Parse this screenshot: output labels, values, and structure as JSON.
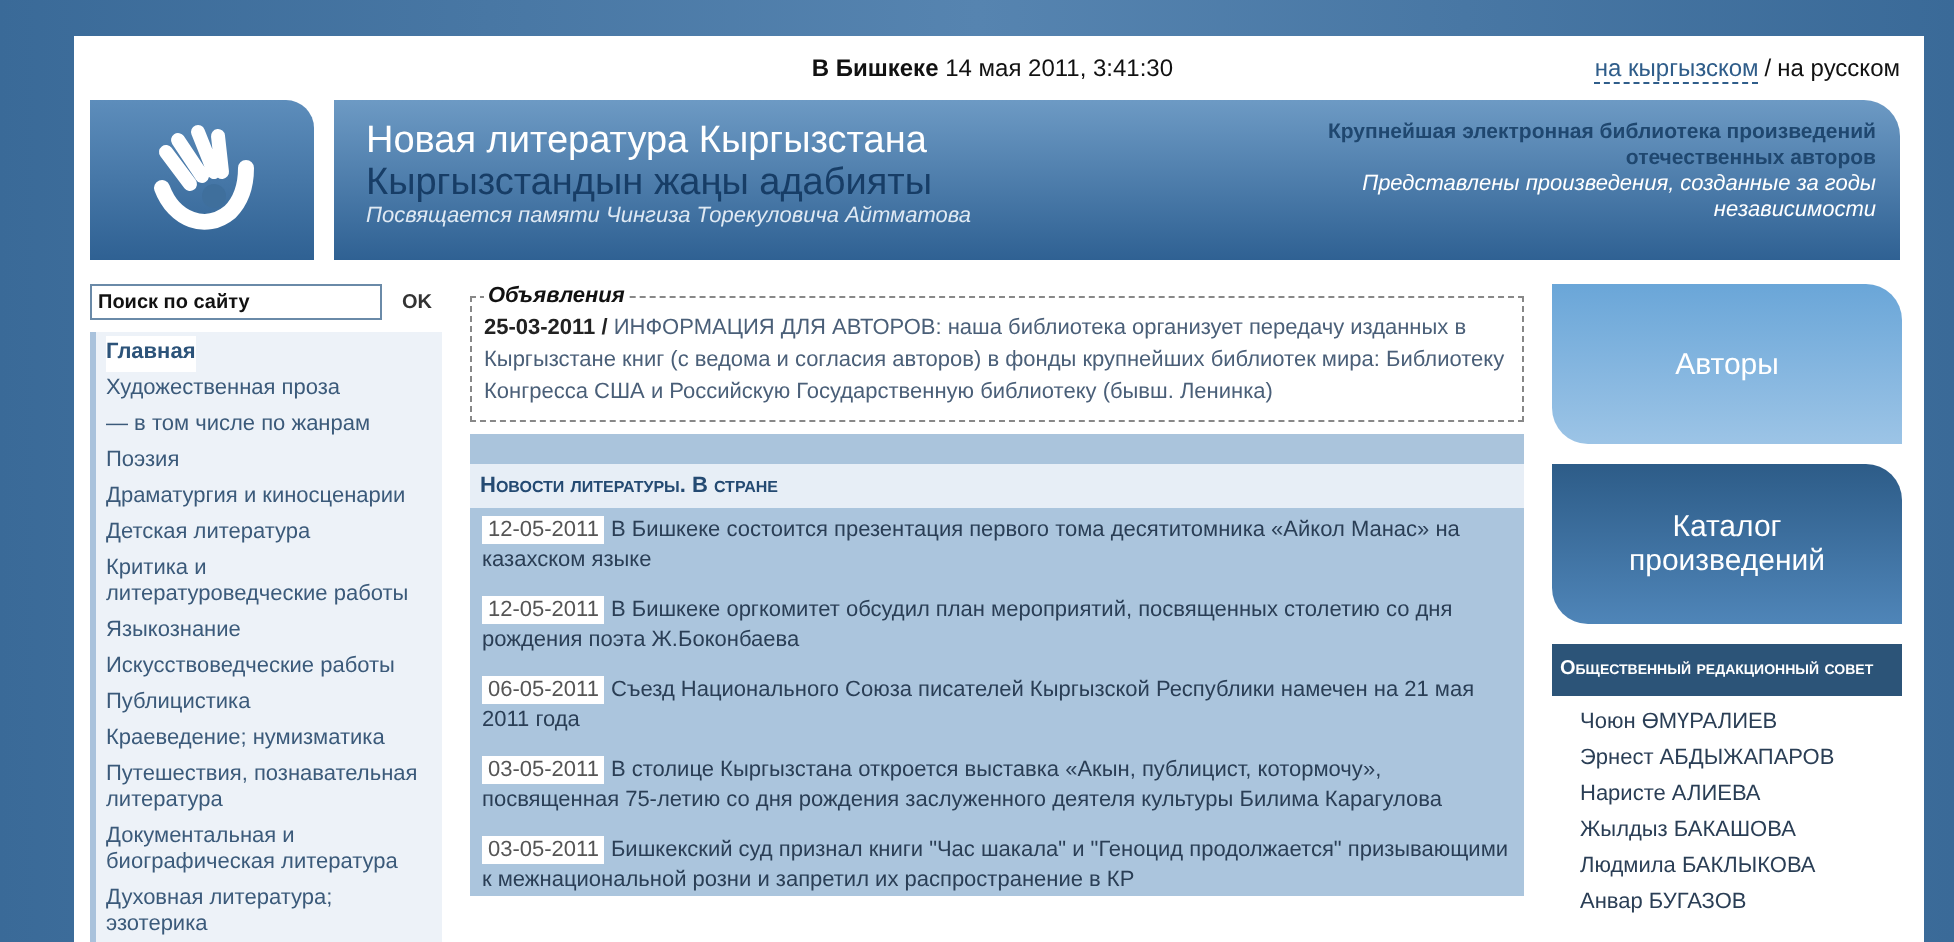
{
  "top_bar": {
    "datetime": "**В Бишкеке** 14 мая 2011, 3:41:30",
    "separator": "/",
    "languages": [
      {
        "label": "на кыргызском",
        "selected": false
      },
      {
        "label": "на русском",
        "selected": true
      }
    ]
  },
  "header": {
    "title": "Новая литература Кыргызстана",
    "subtitle": "Кыргызстандын жаңы адабияты",
    "dedication": "Посвящается памяти Чингиза Торекуловича Айтматова",
    "tagline": "Крупнейшая электронная библиотека произведений отечественных авторов",
    "description": "Представлены произведения, созданные за годы независимости"
  },
  "search": {
    "placeholder": "Поиск по сайту",
    "button": "OK"
  },
  "sidebar": {
    "items": [
      {
        "label": "Главная",
        "selected": true
      },
      {
        "label": "Художественная проза",
        "selected": false
      },
      {
        "label": "— в том числе по жанрам",
        "selected": false
      },
      {
        "label": "Поэзия",
        "selected": false
      },
      {
        "label": "Драматургия и киносценарии",
        "selected": false
      },
      {
        "label": "Детская литература",
        "selected": false
      },
      {
        "label": "Критика и литературоведческие работы",
        "selected": false
      },
      {
        "label": "Языкознание",
        "selected": false
      },
      {
        "label": "Искусствоведческие работы",
        "selected": false
      },
      {
        "label": "Публицистика",
        "selected": false
      },
      {
        "label": "Краеведение; нумизматика",
        "selected": false
      },
      {
        "label": "Путешествия, познавательная литература",
        "selected": false
      },
      {
        "label": "Документальная и биографическая литература",
        "selected": false
      },
      {
        "label": "Духовная литература; эзотерика",
        "selected": false
      }
    ]
  },
  "announcements": {
    "title": "Объявления",
    "text": "**25-03-2011 /** ИНФОРМАЦИЯ ДЛЯ АВТОРОВ: наша библиотека организует передачу изданных в Кыргызстане книг (с ведома и согласия авторов) в фонды крупнейших библиотек мира: Библиотеку Конгресса США и Российскую Государственную библиотеку (бывш. Ленинка)"
  },
  "news": {
    "title": "Новости литературы. В стране",
    "items": [
      {
        "date": "12-05-2011",
        "text": "В Бишкеке состоится презентация первого тома десятитомника «Айкол Манас» на казахском языке"
      },
      {
        "date": "12-05-2011",
        "text": "В Бишкеке оргкомитет обсудил план мероприятий, посвященных столетию со дня рождения поэта Ж.Боконбаева"
      },
      {
        "date": "06-05-2011",
        "text": "Съезд Национального Союза писателей Кыргызской Республики намечен на 21 мая 2011 года"
      },
      {
        "date": "03-05-2011",
        "text": "В столице Кыргызстана откроется выставка «Акын, публицист, котормочу», посвященная 75-летию со дня рождения заслуженного деятеля культуры Билима Карагулова"
      },
      {
        "date": "03-05-2011",
        "text": "Бишкекский суд признал книги \"Час шакала\" и \"Геноцид продолжается\" призывающими к межнациональной розни и запретил их распространение в КР"
      }
    ]
  },
  "right_buttons": [
    {
      "label": "Авторы",
      "kind": "light"
    },
    {
      "label": "Каталог произведений",
      "kind": "dark"
    }
  ],
  "council": {
    "title": "Общественный редакционный совет",
    "members": [
      "Чоюн ӨМҮРАЛИЕВ",
      "Эрнест АБДЫЖАПАРОВ",
      "Наристе АЛИЕВА",
      "Жылдыз БАКАШОВА",
      "Людмила БАКЛЫКОВА",
      "Анвар БУГАЗОВ"
    ]
  }
}
